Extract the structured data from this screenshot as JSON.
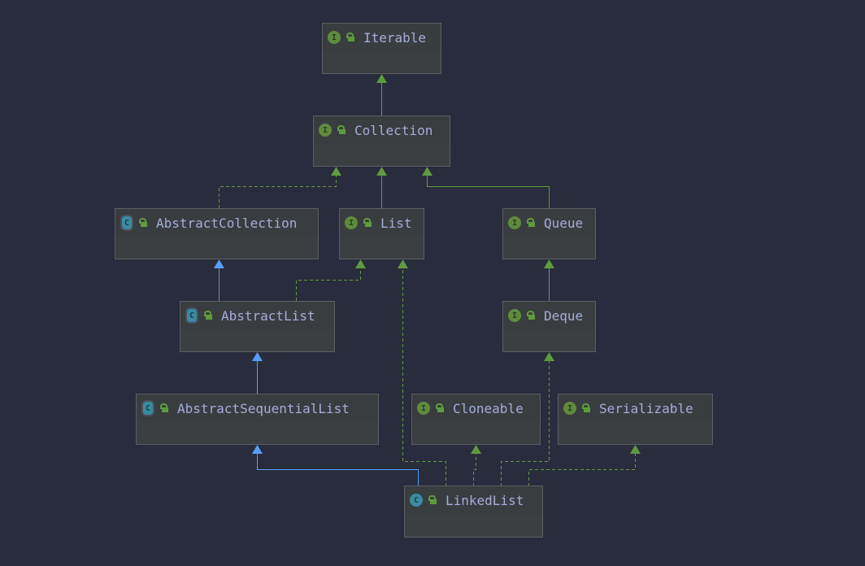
{
  "colors": {
    "background": "#292c3c",
    "implements": "#5f9b3d",
    "extends": "#589df6",
    "text": "#a5acd8"
  },
  "nodes": {
    "iterable": {
      "name": "Iterable",
      "kind": "interface"
    },
    "collection": {
      "name": "Collection",
      "kind": "interface"
    },
    "abstract_collection": {
      "name": "AbstractCollection",
      "kind": "abstract-class"
    },
    "list": {
      "name": "List",
      "kind": "interface"
    },
    "queue": {
      "name": "Queue",
      "kind": "interface"
    },
    "abstract_list": {
      "name": "AbstractList",
      "kind": "abstract-class"
    },
    "deque": {
      "name": "Deque",
      "kind": "interface"
    },
    "abstract_sequential_list": {
      "name": "AbstractSequentialList",
      "kind": "abstract-class"
    },
    "cloneable": {
      "name": "Cloneable",
      "kind": "interface"
    },
    "serializable": {
      "name": "Serializable",
      "kind": "interface"
    },
    "linked_list": {
      "name": "LinkedList",
      "kind": "class"
    }
  },
  "badges": {
    "interface": "I",
    "class": "C"
  },
  "edges": [
    {
      "from": "Collection",
      "to": "Iterable",
      "type": "interface-extends"
    },
    {
      "from": "AbstractCollection",
      "to": "Collection",
      "type": "implements"
    },
    {
      "from": "List",
      "to": "Collection",
      "type": "interface-extends"
    },
    {
      "from": "Queue",
      "to": "Collection",
      "type": "interface-extends"
    },
    {
      "from": "AbstractList",
      "to": "AbstractCollection",
      "type": "extends"
    },
    {
      "from": "AbstractList",
      "to": "List",
      "type": "implements"
    },
    {
      "from": "Deque",
      "to": "Queue",
      "type": "interface-extends"
    },
    {
      "from": "AbstractSequentialList",
      "to": "AbstractList",
      "type": "extends"
    },
    {
      "from": "LinkedList",
      "to": "AbstractSequentialList",
      "type": "extends"
    },
    {
      "from": "LinkedList",
      "to": "List",
      "type": "implements"
    },
    {
      "from": "LinkedList",
      "to": "Cloneable",
      "type": "implements"
    },
    {
      "from": "LinkedList",
      "to": "Deque",
      "type": "implements"
    },
    {
      "from": "LinkedList",
      "to": "Serializable",
      "type": "implements"
    }
  ]
}
